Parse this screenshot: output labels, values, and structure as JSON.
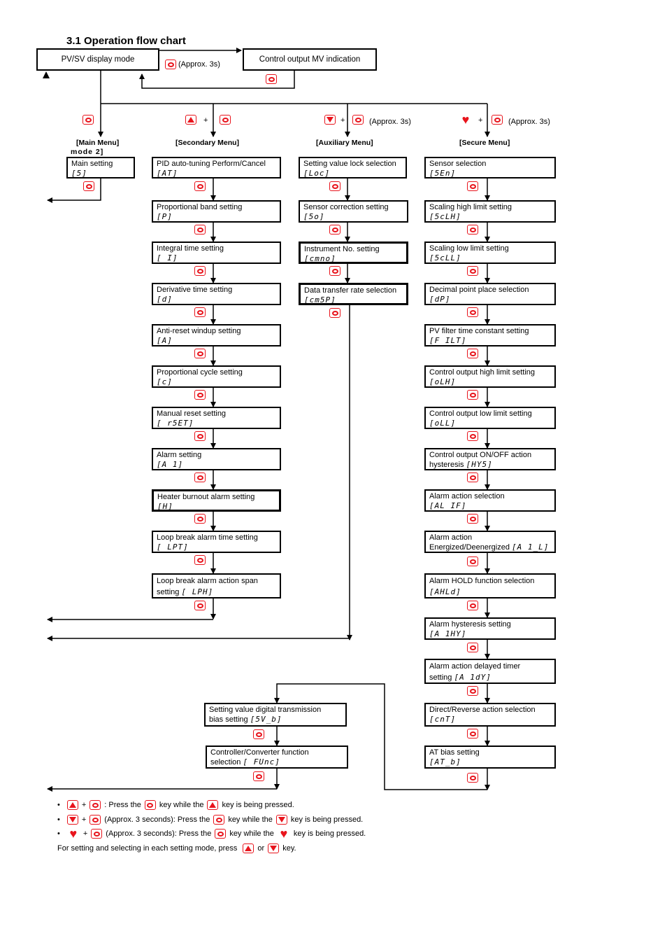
{
  "title": "3.1 Operation flow chart",
  "top": {
    "pvsv_box": "PV/SV display mode",
    "mv_box": "Control output MV indication",
    "mv_key_note": "(Approx. 3s)"
  },
  "branches": {
    "main": {
      "header_line1": "[Main  Menu]",
      "header_line2": "mode 2]"
    },
    "secondary": {
      "header": "[Secondary  Menu]",
      "plus": "+"
    },
    "auxiliary": {
      "header": "[Auxiliary  Menu]",
      "plus": "+",
      "note": "(Approx.  3s)"
    },
    "secure": {
      "header": "[Secure  Menu]",
      "plus": "+",
      "note": "(Approx.  3s)"
    }
  },
  "icons": {
    "mode_key": "mode-key-icon",
    "up_key": "up-key-icon",
    "down_key": "down-key-icon",
    "heart_key": "heart-key-icon"
  },
  "colors": {
    "key_red": "#e8141c",
    "line": "#000000"
  },
  "main_menu": [
    {
      "label": "Main setting",
      "code": "[5]"
    }
  ],
  "secondary_menu": [
    {
      "label": "PID auto-tuning Perform/Cancel",
      "code": "[AT]"
    },
    {
      "label": "Proportional band setting",
      "code": "[P]"
    },
    {
      "label": "Integral time setting",
      "code": "[ I]"
    },
    {
      "label": "Derivative time setting",
      "code": "[d]"
    },
    {
      "label": "Anti-reset windup setting",
      "code": "[A]"
    },
    {
      "label": "Proportional cycle setting",
      "code": "[c]"
    },
    {
      "label": "Manual reset setting",
      "code": "[ r5ET]"
    },
    {
      "label": "Alarm setting",
      "code": "[A 1]"
    },
    {
      "label": "Heater burnout alarm setting",
      "code": "[H]"
    },
    {
      "label": "Loop break alarm time setting",
      "code": "[ LPT]"
    },
    {
      "label": "Loop break alarm action span",
      "label2": "setting",
      "code": "[ LPH]"
    }
  ],
  "auxiliary_menu": [
    {
      "label": "Setting value lock selection",
      "code": "[Loc]"
    },
    {
      "label": "Sensor correction setting",
      "code": "[5o]"
    },
    {
      "label": "Instrument No. setting",
      "code": "[cmno]"
    },
    {
      "label": "Data transfer rate selection",
      "code": "[cm5P]"
    }
  ],
  "auxiliary_extra": [
    {
      "label": "Setting value digital transmission",
      "label2": "bias setting",
      "code": "[5V_b]"
    },
    {
      "label": "Controller/Converter function",
      "label2": "selection",
      "code": "[ FUnc]"
    }
  ],
  "secure_menu": [
    {
      "label": "Sensor selection",
      "code": "[5En]"
    },
    {
      "label": "Scaling high limit setting",
      "code": "[5cLH]"
    },
    {
      "label": "Scaling low limit setting",
      "code": "[5cLL]"
    },
    {
      "label": "Decimal point place selection",
      "code": "[dP]"
    },
    {
      "label": "PV filter time constant setting",
      "code": "[F ILT]"
    },
    {
      "label": "Control output high limit setting",
      "code": "[oLH]"
    },
    {
      "label": "Control output low limit setting",
      "code": "[oLL]"
    },
    {
      "label": "Control output ON/OFF action",
      "label2": "hysteresis",
      "code": "[HY5]"
    },
    {
      "label": "Alarm action selection",
      "code": "[AL IF]"
    },
    {
      "label": "Alarm action",
      "label2": "Energized/Deenergized",
      "code": "[A 1_L]"
    },
    {
      "label": "Alarm HOLD function selection",
      "code": "[AHLd]"
    },
    {
      "label": "Alarm hysteresis setting",
      "code": "[A 1HY]"
    },
    {
      "label": "Alarm action delayed timer",
      "label2": "setting",
      "code": "[A 1dY]"
    },
    {
      "label": "Direct/Reverse action selection",
      "code": "[cnT]"
    },
    {
      "label": "AT bias setting",
      "code": "[AT_b]"
    }
  ],
  "legend": {
    "bullet": "•",
    "plus": "+",
    "line1_a": ": Press the",
    "line1_b": "key while the",
    "line1_c": "key is being pressed.",
    "line2_a": "(Approx. 3 seconds): Press the",
    "line2_b": "key while the",
    "line2_c": "key is being pressed.",
    "line3_a": "(Approx. 3 seconds): Press the",
    "line3_b": "key while the",
    "line3_c": "key is being pressed.",
    "line4_a": "For setting and selecting in each setting mode, press",
    "line4_or": "or",
    "line4_b": "key."
  }
}
